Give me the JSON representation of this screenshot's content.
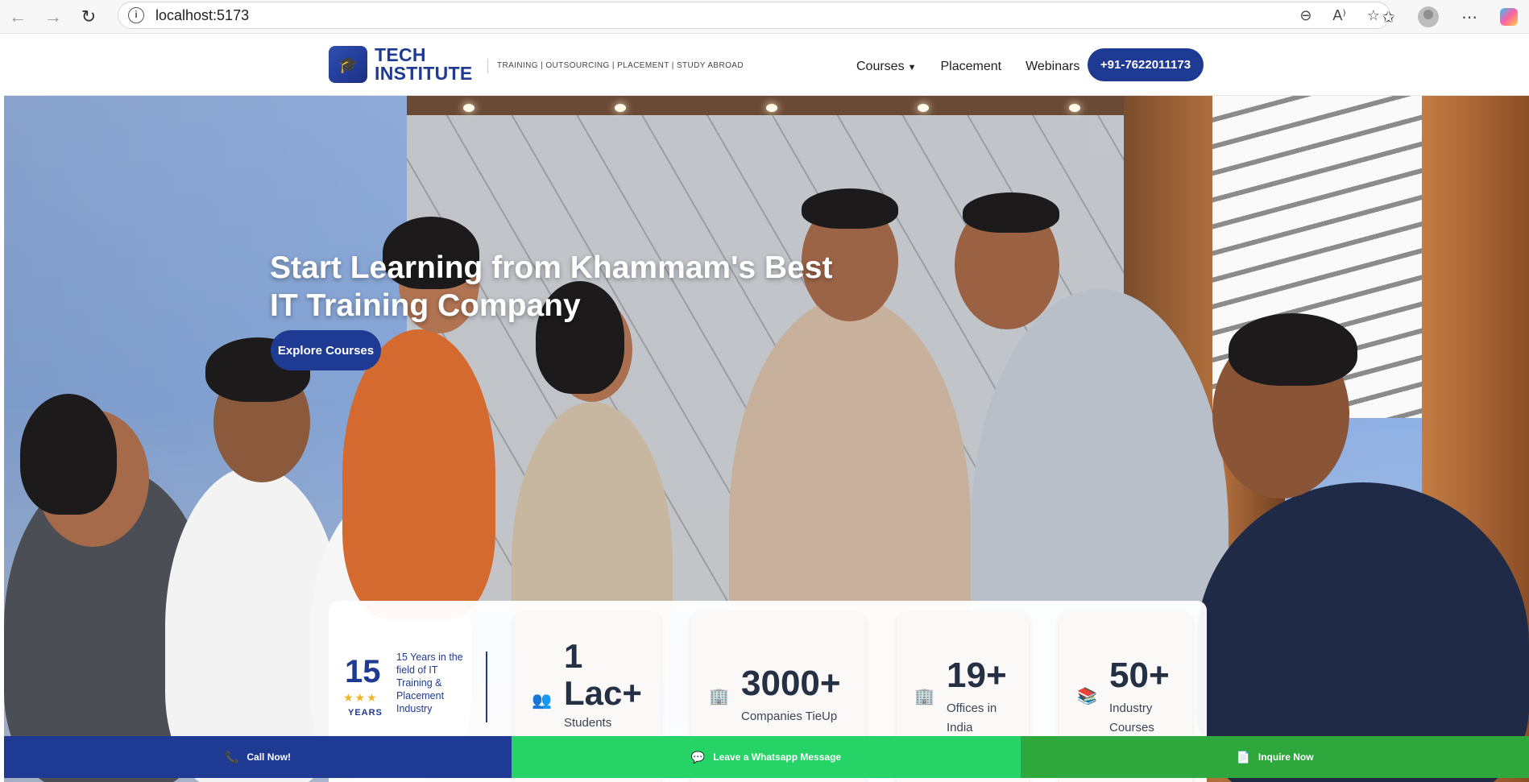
{
  "browser": {
    "url": "localhost:5173",
    "icons": [
      "back-icon",
      "forward-icon",
      "refresh-icon",
      "info-icon",
      "zoom-out-icon",
      "read-aloud-icon",
      "favorite-star-icon",
      "favorites-icon",
      "profile-icon",
      "more-icon",
      "copilot-icon"
    ]
  },
  "header": {
    "logo_line1": "TECH",
    "logo_line2": "INSTITUTE",
    "tagline": "TRAINING | OUTSOURCING | PLACEMENT | STUDY ABROAD",
    "nav": {
      "courses": "Courses",
      "placement": "Placement",
      "webinars": "Webinars"
    },
    "phone": "+91-7622011173",
    "brand_color": "#1f3a93"
  },
  "hero": {
    "title_line1": "Start Learning from Khammam's Best",
    "title_line2": "IT Training Company",
    "cta": "Explore Courses"
  },
  "stats": {
    "years_number": "15",
    "years_label": "YEARS",
    "years_desc": "15 Years in the field of IT Training & Placement Industry",
    "cards": [
      {
        "number": "1 Lac+",
        "label": "Students",
        "icon": "students-icon"
      },
      {
        "number": "3000+",
        "label": "Companies TieUp",
        "icon": "building-icon"
      },
      {
        "number": "19+",
        "label": "Offices in India",
        "icon": "office-icon"
      },
      {
        "number": "50+",
        "label": "Industry Courses",
        "icon": "books-icon"
      }
    ]
  },
  "bottom_bar": {
    "call": "Call Now!",
    "whatsapp": "Leave a Whatsapp Message",
    "inquire": "Inquire Now",
    "colors": {
      "call": "#1f3a93",
      "whatsapp": "#25d366",
      "inquire": "#2ea73c"
    }
  }
}
